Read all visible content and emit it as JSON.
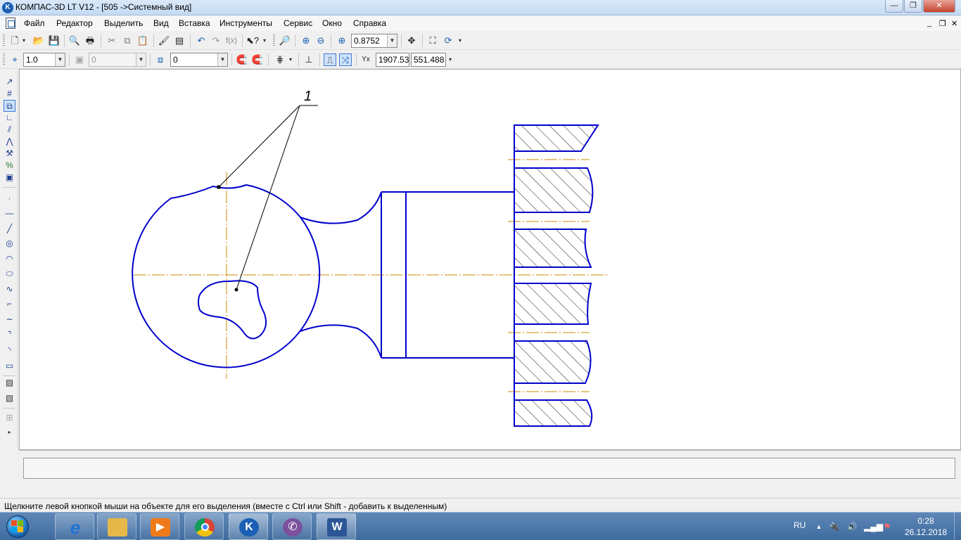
{
  "window": {
    "title": "КОМПАС-3D LT V12 - [505 ->Системный вид]",
    "app_icon": "kompas-logo-icon",
    "controls": [
      "minimize-icon",
      "maximize-icon",
      "close-icon"
    ]
  },
  "menu": {
    "items": [
      {
        "label": "Файл"
      },
      {
        "label": "Редактор"
      },
      {
        "label": "Выделить"
      },
      {
        "label": "Вид"
      },
      {
        "label": "Вставка"
      },
      {
        "label": "Инструменты"
      },
      {
        "label": "Сервис"
      },
      {
        "label": "Окно"
      },
      {
        "label": "Справка"
      }
    ],
    "mdi_controls": [
      "minimize-icon",
      "restore-icon",
      "close-icon"
    ]
  },
  "standard_toolbar": {
    "icons": [
      "new-document-icon",
      "open-icon",
      "save-icon",
      "print-preview-icon",
      "print-icon",
      "cut-icon",
      "copy-icon",
      "paste-icon",
      "properties-icon",
      "library-icon",
      "undo-icon",
      "redo-icon",
      "function-icon",
      "help-pointer-icon",
      "zoom-window-icon",
      "zoom-in-icon",
      "zoom-out-icon",
      "zoom-scale-icon",
      "pan-icon",
      "show-all-icon",
      "refresh-icon"
    ],
    "zoom_value": "0.8752"
  },
  "current_state_toolbar": {
    "icons": [
      "local-cs-icon",
      "layer-icon",
      "style-icon",
      "snap-icon",
      "grid-icon",
      "ortho-icon",
      "round-icon",
      "cursor-coords-icon"
    ],
    "step_value": "1.0",
    "layer_value": "0",
    "style_value": "0",
    "cursor_x": "1907.53",
    "cursor_y": "551.488"
  },
  "compact_toolbar": {
    "icons": [
      "geometry-icon",
      "dimensions-icon",
      "designations-icon",
      "edit-icon",
      "parametrization-icon",
      "measure-icon",
      "selection-icon",
      "spec-icon",
      "point-icon",
      "auxiliary-line-icon",
      "segment-icon",
      "circle-icon",
      "arc-icon",
      "ellipse-icon",
      "spline-icon",
      "polyline-icon",
      "bezier-icon",
      "chamfer-icon",
      "fillet-icon",
      "rectangle-icon",
      "hatch-icon",
      "hatch-boundary-icon",
      "macro-icon"
    ],
    "active_index": 2
  },
  "drawing": {
    "leader_label": "1",
    "contour_color": "#0000cc",
    "axis_color": "#cc8a00",
    "leader_color": "#000000"
  },
  "status": {
    "message": "Щелкните левой кнопкой мыши на объекте для его выделения (вместе с Ctrl или Shift - добавить к выделенным)"
  },
  "taskbar": {
    "apps": [
      {
        "name": "internet-explorer-icon",
        "color": "#1e73d8"
      },
      {
        "name": "file-explorer-icon",
        "color": "#e6b84a"
      },
      {
        "name": "media-player-icon",
        "color": "#f07a1a"
      },
      {
        "name": "chrome-icon",
        "color": "#2aa84a"
      },
      {
        "name": "kompas-icon",
        "color": "#1a5fb4"
      },
      {
        "name": "viber-icon",
        "color": "#7b519d"
      },
      {
        "name": "word-icon",
        "color": "#2b5797"
      }
    ],
    "language": "RU",
    "tray_icons": [
      "show-hidden-icons-arrow",
      "safely-remove-icon",
      "volume-icon",
      "network-signal-icon",
      "action-center-icon"
    ],
    "time": "0:28",
    "date": "26.12.2018"
  }
}
